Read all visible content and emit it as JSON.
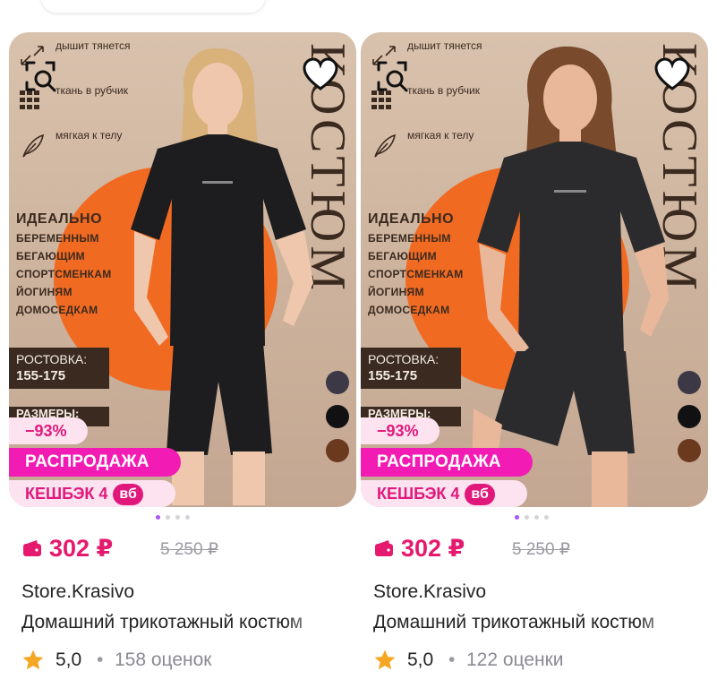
{
  "colors": {
    "price": "#e5196e",
    "sale_badge": "#f21bb4",
    "discount_bg": "#fde3f0",
    "accent_orange": "#f16a22",
    "brand_brown": "#3b2a1f",
    "star": "#f5a623"
  },
  "products": [
    {
      "image": {
        "vertical_word": "КОСТЮМ",
        "feature1": "дышит тянется",
        "feature2": "ткань в рубчик",
        "feature3": "мягкая к телу",
        "ideal_title": "ИДЕАЛЬНО",
        "ideal_lines": [
          "БЕРЕМЕННЫМ",
          "БЕГАЮЩИМ",
          "СПОРТСМЕНКАМ",
          "ЙОГИНЯМ",
          "ДОМОСЕДКАМ"
        ],
        "rost_label": "РОСТОВКА:",
        "rost_value": "155-175",
        "sizes_label": "РАЗМЕРЫ:",
        "person_skin": "#efc7ad",
        "person_hair": "#d8b27a",
        "outfit": "#1d1d1f"
      },
      "search_icon": "image-search-icon",
      "favorite_icon": "heart-outline-icon",
      "discount": "−93%",
      "sale_label": "РАСПРОДАЖА",
      "cashback_label": "КЕШБЭК 4",
      "cashback_badge": "вб",
      "carousel_total": 4,
      "carousel_active": 0,
      "price": "302 ₽",
      "old_price": "5 250 ₽",
      "brand": "Store.Krasivo",
      "title": "Домашний трикотажный костюм",
      "rating": "5,0",
      "separator": "•",
      "reviews": "158 оценок"
    },
    {
      "image": {
        "vertical_word": "КОСТЮМ",
        "feature1": "дышит тянется",
        "feature2": "ткань в рубчик",
        "feature3": "мягкая к телу",
        "ideal_title": "ИДЕАЛЬНО",
        "ideal_lines": [
          "БЕРЕМЕННЫМ",
          "БЕГАЮЩИМ",
          "СПОРТСМЕНКАМ",
          "ЙОГИНЯМ",
          "ДОМОСЕДКАМ"
        ],
        "rost_label": "РОСТОВКА:",
        "rost_value": "155-175",
        "sizes_label": "РАЗМЕРЫ:",
        "person_skin": "#e9b79a",
        "person_hair": "#7a4a2c",
        "outfit": "#2b2b2e"
      },
      "search_icon": "image-search-icon",
      "favorite_icon": "heart-outline-icon",
      "discount": "−93%",
      "sale_label": "РАСПРОДАЖА",
      "cashback_label": "КЕШБЭК 4",
      "cashback_badge": "вб",
      "carousel_total": 4,
      "carousel_active": 0,
      "price": "302 ₽",
      "old_price": "5 250 ₽",
      "brand": "Store.Krasivo",
      "title": "Домашний трикотажный костюм",
      "rating": "5,0",
      "separator": "•",
      "reviews": "122 оценки"
    }
  ]
}
